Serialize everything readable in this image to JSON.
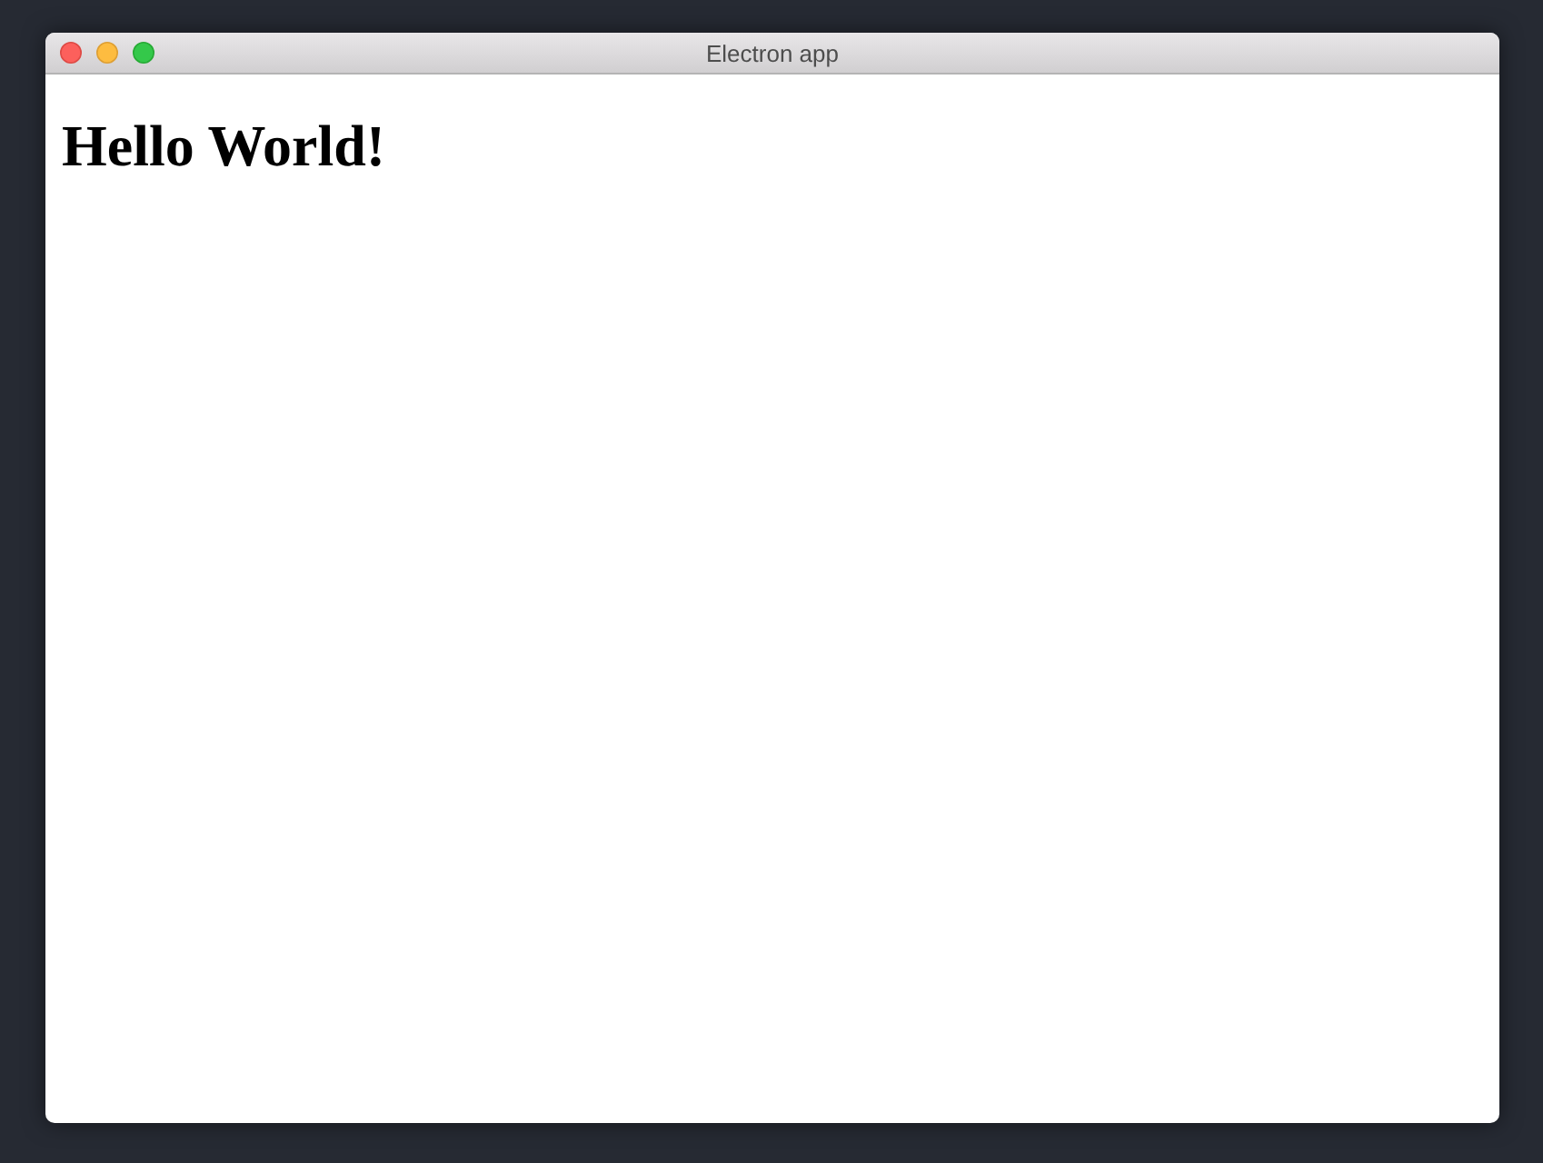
{
  "window": {
    "title": "Electron app"
  },
  "content": {
    "heading": "Hello World!"
  }
}
